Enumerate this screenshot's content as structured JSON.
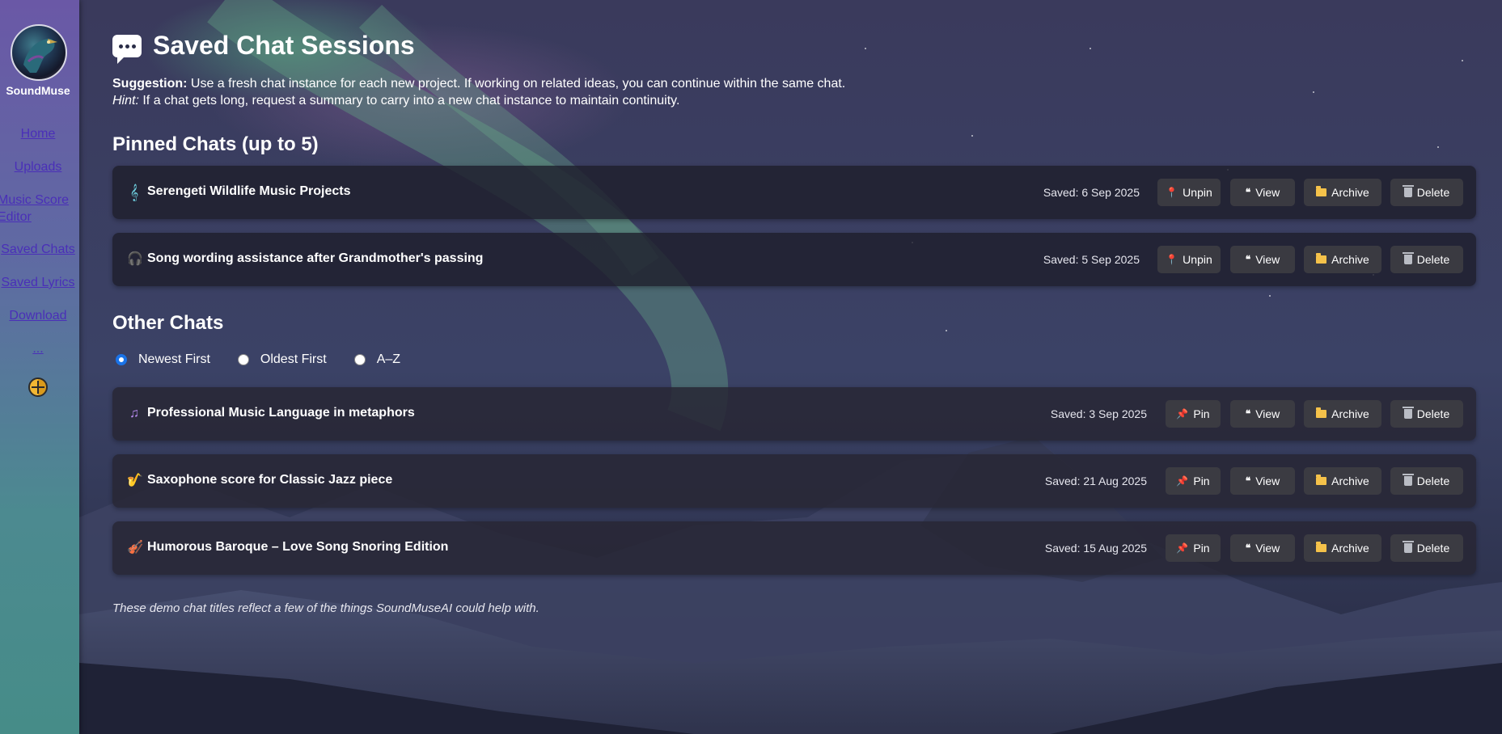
{
  "sidebar": {
    "brand": "SoundMuse",
    "nav": [
      "Home",
      "Uploads",
      "Music Score Editor",
      "Saved Chats",
      "Saved Lyrics",
      "Download",
      "..."
    ]
  },
  "page": {
    "title": "Saved Chat Sessions",
    "suggestion_label": "Suggestion:",
    "suggestion_text": "Use a fresh chat instance for each new project. If working on related ideas, you can continue within the same chat.",
    "hint_label": "Hint:",
    "hint_text": "If a chat gets long, request a summary to carry into a new chat instance to maintain continuity."
  },
  "pinned": {
    "heading": "Pinned Chats (up to 5)",
    "items": [
      {
        "icon": "treble-clef-icon",
        "title": "Serengeti Wildlife Music Projects",
        "saved": "Saved: 6 Sep 2025",
        "pin_label": "Unpin"
      },
      {
        "icon": "headphones-icon",
        "title": "Song wording assistance after Grandmother's passing",
        "saved": "Saved: 5 Sep 2025",
        "pin_label": "Unpin"
      }
    ]
  },
  "other": {
    "heading": "Other Chats",
    "sort_options": [
      "Newest First",
      "Oldest First",
      "A–Z"
    ],
    "sort_selected": "Newest First",
    "items": [
      {
        "icon": "music-notes-icon",
        "title": "Professional Music Language in metaphors",
        "saved": "Saved: 3 Sep 2025",
        "pin_label": "Pin"
      },
      {
        "icon": "saxophone-icon",
        "title": "Saxophone score for Classic Jazz piece",
        "saved": "Saved: 21 Aug 2025",
        "pin_label": "Pin"
      },
      {
        "icon": "violin-icon",
        "title": "Humorous Baroque – Love Song Snoring Edition",
        "saved": "Saved: 15 Aug 2025",
        "pin_label": "Pin"
      }
    ]
  },
  "actions": {
    "view": "View",
    "archive": "Archive",
    "delete": "Delete"
  },
  "footnote": "These demo chat titles reflect a few of the things SoundMuseAI could help with.",
  "colors": {
    "sidebar_top": "#6a58a6",
    "sidebar_bottom": "#468c88",
    "link": "#4a2fb8",
    "pin": "#e53935",
    "folder": "#f5c24a"
  }
}
